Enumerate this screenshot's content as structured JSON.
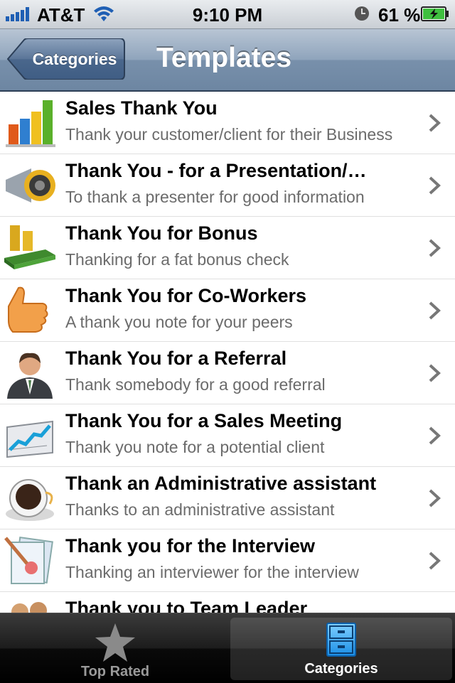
{
  "status": {
    "carrier": "AT&T",
    "time": "9:10 PM",
    "battery": "61 %"
  },
  "nav": {
    "back_label": "Categories",
    "title": "Templates"
  },
  "rows": [
    {
      "title": "Sales Thank You",
      "subtitle": "Thank your customer/client for their Business",
      "icon": "bar-chart-icon"
    },
    {
      "title": "Thank You - for a Presentation/…",
      "subtitle": "To thank a presenter for good information",
      "icon": "megaphone-icon"
    },
    {
      "title": "Thank You for Bonus",
      "subtitle": "Thanking for a fat bonus check",
      "icon": "money-icon"
    },
    {
      "title": "Thank You for Co-Workers",
      "subtitle": "A thank you note for your peers",
      "icon": "thumbs-up-icon"
    },
    {
      "title": "Thank You for a Referral",
      "subtitle": "Thank somebody for a good referral",
      "icon": "businessman-icon"
    },
    {
      "title": "Thank You for a Sales Meeting",
      "subtitle": "Thank you note for a potential client",
      "icon": "line-chart-icon"
    },
    {
      "title": "Thank an Administrative assistant",
      "subtitle": "Thanks to an administrative assistant",
      "icon": "coffee-cup-icon"
    },
    {
      "title": "Thank you for the Interview",
      "subtitle": "Thanking an interviewer for the interview",
      "icon": "documents-icon"
    },
    {
      "title": "Thank you to Team Leader",
      "subtitle": "",
      "icon": "team-icon"
    }
  ],
  "tabs": [
    {
      "label": "Top Rated",
      "icon": "star-icon"
    },
    {
      "label": "Categories",
      "icon": "cabinet-icon"
    }
  ]
}
